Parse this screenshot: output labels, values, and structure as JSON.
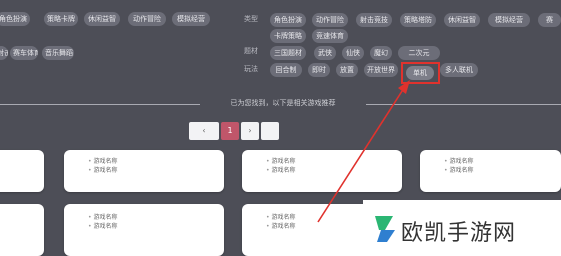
{
  "filters": {
    "top_left_pills": [
      "角色扮演",
      "策略卡牌",
      "休闲益智",
      "动作冒险",
      "模拟经营"
    ],
    "second_left_pills": [
      "射击竞技",
      "赛车体育",
      "音乐舞蹈"
    ],
    "row_labels": [
      "类型",
      "题材",
      "玩法"
    ],
    "type_pills": [
      "角色扮演",
      "动作冒险",
      "射击竞技",
      "策略塔防",
      "休闲益智",
      "模拟经营",
      "赛"
    ],
    "type_pills_2": [
      "卡牌策略",
      "竞速体育"
    ],
    "theme_pills": [
      "三国题材",
      "武侠",
      "仙侠",
      "魔幻",
      "二次元"
    ],
    "play_pills": [
      "回合制",
      "即时",
      "放置",
      "开放世界",
      "单机",
      "多人联机"
    ],
    "selected_play": "单机"
  },
  "separator_hint": "已为您找到，以下是相关游戏推荐",
  "pagination": {
    "prev": "‹",
    "pages": [
      "1"
    ],
    "active": "1",
    "next": "›"
  },
  "cards_row1": [
    {
      "items": []
    },
    {
      "items": [
        "游戏名称",
        "游戏名称"
      ]
    },
    {
      "items": [
        "游戏名称",
        "游戏名称"
      ]
    },
    {
      "items": [
        "游戏名称",
        "游戏名称"
      ]
    }
  ],
  "cards_row2": [
    {
      "items": []
    },
    {
      "items": [
        "游戏名称",
        "游戏名称"
      ]
    },
    {
      "items": [
        "游戏名称",
        "游戏名称"
      ]
    }
  ],
  "watermark": {
    "text": "欧凯手游网"
  },
  "colors": {
    "highlight": "#e0322d",
    "page_active": "#c0566a",
    "background": "#4d4e57"
  }
}
